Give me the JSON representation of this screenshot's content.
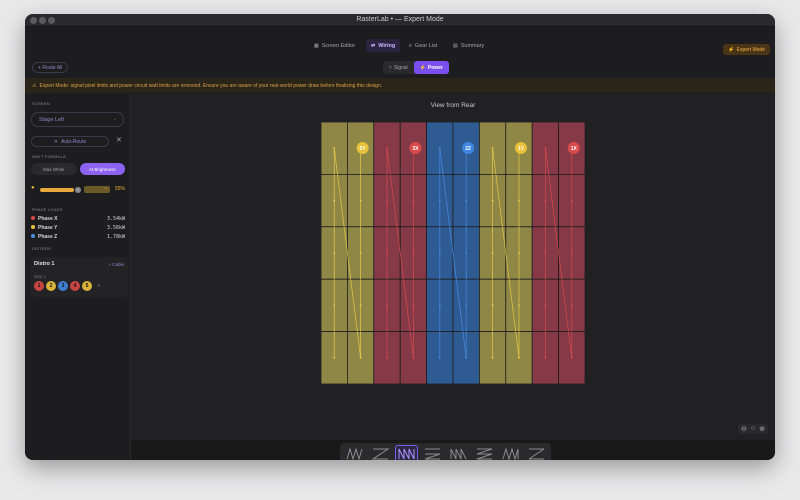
{
  "window": {
    "title": "RasterLab • — Expert Mode"
  },
  "nav": {
    "tabs": [
      {
        "label": "Screen Editor",
        "icon": "grid-icon",
        "active": false
      },
      {
        "label": "Wiring",
        "icon": "link-icon",
        "active": true
      },
      {
        "label": "Gear List",
        "icon": "list-icon",
        "active": false
      },
      {
        "label": "Summary",
        "icon": "doc-icon",
        "active": false
      }
    ],
    "expert_mode_label": "Expert Mode"
  },
  "subbar": {
    "route_all_label": "Route All",
    "modes": [
      {
        "label": "Signal",
        "active": false
      },
      {
        "label": "Power",
        "active": true
      }
    ]
  },
  "warning": {
    "text": "Expert Mode: signal pixel limits and power circuit watt limits are removed. Ensure you are aware of your real-world power draw before finalizing this design."
  },
  "sidebar": {
    "screen_label": "SCREEN",
    "screen_value": "Stage Left",
    "autoroute_label": "Auto-Route",
    "watt_formula_label": "WATT FORMULA",
    "watt_options": [
      {
        "label": "Max White",
        "active": false
      },
      {
        "label": "At Brightness",
        "active": true
      }
    ],
    "brightness_percent": "55%",
    "phase_loads_label": "PHASE LOADS",
    "phases": [
      {
        "name": "Phase X",
        "load": "3.54kW",
        "color": "#d94b4b"
      },
      {
        "name": "Phase Y",
        "load": "3.56kW",
        "color": "#e8c23a"
      },
      {
        "name": "Phase Z",
        "load": "1.78kW",
        "color": "#4a8fe0"
      }
    ],
    "distros_label": "DISTROS",
    "distro": {
      "name": "Distro 1",
      "cable_label": "+ Cable",
      "soc_label": "SOC 1",
      "circuits": [
        {
          "n": "1",
          "color": "#c84545"
        },
        {
          "n": "2",
          "color": "#d9b23a"
        },
        {
          "n": "3",
          "color": "#3f7fd0"
        },
        {
          "n": "4",
          "color": "#c84545"
        },
        {
          "n": "5",
          "color": "#d9b23a"
        }
      ],
      "add_label": "+"
    }
  },
  "main": {
    "view_title": "View from Rear",
    "columns": [
      {
        "phase": "Y",
        "color": "#8f8745"
      },
      {
        "phase": "Y",
        "color": "#8f8745"
      },
      {
        "phase": "X",
        "color": "#863a48"
      },
      {
        "phase": "X",
        "color": "#863a48"
      },
      {
        "phase": "Z",
        "color": "#2f5b93"
      },
      {
        "phase": "Z",
        "color": "#2f5b93"
      },
      {
        "phase": "Y",
        "color": "#8f8745"
      },
      {
        "phase": "Y",
        "color": "#8f8745"
      },
      {
        "phase": "X",
        "color": "#863a48"
      },
      {
        "phase": "X",
        "color": "#863a48"
      }
    ],
    "circuit_badges": [
      {
        "label": "5Y",
        "color": "#e8c23a"
      },
      {
        "label": "3X",
        "color": "#d94b4b"
      },
      {
        "label": "2Z",
        "color": "#3f86e0"
      },
      {
        "label": "1Y",
        "color": "#e8c23a"
      },
      {
        "label": "1X",
        "color": "#d94b4b"
      }
    ]
  },
  "zoom_controls": [
    "zoom-out-icon",
    "reset-icon",
    "zoom-in-icon"
  ],
  "patterns": {
    "selected_index": 2,
    "items": [
      "pattern-1-icon",
      "pattern-2-icon",
      "pattern-3-icon",
      "pattern-4-icon",
      "pattern-5-icon",
      "pattern-6-icon",
      "pattern-7-icon",
      "pattern-8-icon"
    ]
  }
}
